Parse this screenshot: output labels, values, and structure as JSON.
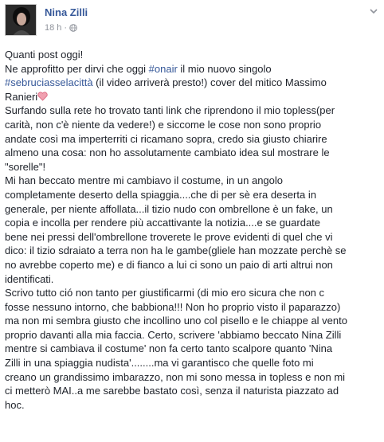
{
  "post": {
    "author": "Nina Zilli",
    "time": "18 h",
    "separator": "·",
    "lines": [
      {
        "text": "Quanti post oggi!"
      },
      {
        "parts": [
          {
            "t": "Ne approfitto per dirvi che oggi ",
            "tag": false
          },
          {
            "t": "#onair",
            "tag": true
          },
          {
            "t": " il mio nuovo singolo",
            "tag": false
          }
        ]
      },
      {
        "parts": [
          {
            "t": "#sebruciasselacittà",
            "tag": true
          },
          {
            "t": " (il video arriverà presto!) cover del mitico Massimo",
            "tag": false
          }
        ]
      },
      {
        "text": "Ranieri",
        "heart": true
      },
      {
        "text": "Surfando sulla rete ho trovato tanti link che riprendono il mio topless(per"
      },
      {
        "text": "carità, non c'è niente da vedere!) e siccome le cose non sono proprio"
      },
      {
        "text": "andate così ma imperterriti ci ricamano sopra, credo sia giusto chiarire"
      },
      {
        "text": "almeno una cosa: non ho assolutamente cambiato idea sul mostrare le"
      },
      {
        "text": "\"sorelle\"!"
      },
      {
        "text": "Mi han beccato mentre mi cambiavo il costume, in un angolo"
      },
      {
        "text": "completamente deserto della spiaggia....che di per sè era deserta in"
      },
      {
        "text": "generale, per niente affollata...il tizio nudo con ombrellone è un fake, un"
      },
      {
        "text": "copia e incolla per rendere più accattivante la notizia....e se guardate"
      },
      {
        "text": "bene nei pressi dell'ombrellone troverete le prove evidenti di quel che vi"
      },
      {
        "text": "dico: il tizio sdraiato a terra non ha le gambe(gliele han mozzate perchè se"
      },
      {
        "text": "no avrebbe coperto me) e di fianco a lui ci sono un paio di arti altrui non"
      },
      {
        "text": "identificati."
      },
      {
        "text": "Scrivo tutto ció non tanto per giustificarmi (di mio ero sicura che non c"
      },
      {
        "text": "fosse nessuno intorno, che babbiona!!! Non ho proprio visto il paparazzo)"
      },
      {
        "text": "ma non mi sembra giusto che incollino uno col pisello e le chiappe al vento"
      },
      {
        "text": "proprio davanti alla mia faccia. Certo, scrivere 'abbiamo beccato Nina Zilli"
      },
      {
        "text": "mentre si cambiava il costume' non fa certo tanto scalpore quanto 'Nina"
      },
      {
        "text": "Zilli in una spiaggia nudista'........ma vi garantisco che quelle foto mi"
      },
      {
        "text": "creano un grandissimo imbarazzo, non mi sono messa in topless e non mi"
      },
      {
        "text": "ci metterò MAI..a me sarebbe bastato così, senza il naturista piazzato ad"
      },
      {
        "text": "hoc."
      }
    ]
  },
  "colors": {
    "link": "#365899",
    "text": "#1d2129",
    "meta": "#90949c",
    "heart": "#f0a0b0"
  },
  "icons": {
    "globe": "globe-icon",
    "menu": "chevron-down-icon",
    "heart": "heart-icon"
  }
}
